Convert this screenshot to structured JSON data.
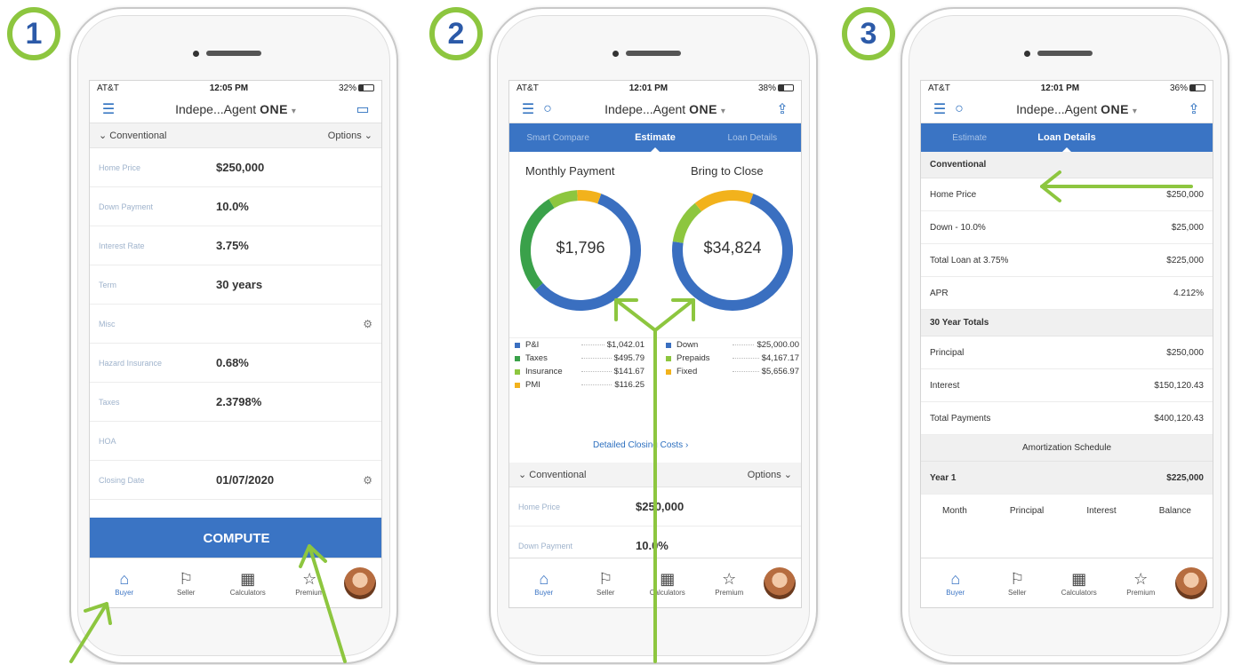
{
  "badges": [
    "1",
    "2",
    "3"
  ],
  "colors": {
    "accent": "#3a74c4",
    "green": "#8dc63f",
    "donut_blue": "#3a6fc0",
    "donut_green_dark": "#3aa14a",
    "donut_green_light": "#8dc63f",
    "donut_yellow": "#f2b21c"
  },
  "status": {
    "p1": {
      "carrier": "AT&T",
      "time": "12:05 PM",
      "battery": "32%"
    },
    "p2": {
      "carrier": "AT&T",
      "time": "12:01 PM",
      "battery": "38%"
    },
    "p3": {
      "carrier": "AT&T",
      "time": "12:01 PM",
      "battery": "36%"
    }
  },
  "nav": {
    "title_prefix": "Indepe...Agent",
    "title_brand": "ONE",
    "chevron": "▾"
  },
  "phone1": {
    "section": "Conventional",
    "options_label": "Options",
    "fields": [
      {
        "label": "Home Price",
        "value": "$250,000"
      },
      {
        "label": "Down Payment",
        "value": "10.0%"
      },
      {
        "label": "Interest Rate",
        "value": "3.75%"
      },
      {
        "label": "Term",
        "value": "30 years"
      },
      {
        "label": "Misc",
        "value": ""
      },
      {
        "label": "Hazard Insurance",
        "value": "0.68%"
      },
      {
        "label": "Taxes",
        "value": "2.3798%"
      },
      {
        "label": "HOA",
        "value": ""
      },
      {
        "label": "Closing Date",
        "value": "01/07/2020"
      }
    ],
    "compute": "COMPUTE"
  },
  "bottom_tabs": [
    "Buyer",
    "Seller",
    "Calculators",
    "Premium"
  ],
  "phone2": {
    "tabs": [
      "Smart Compare",
      "Estimate",
      "Loan Details"
    ],
    "monthly_title": "Monthly Payment",
    "monthly_value": "$1,796",
    "close_title": "Bring to Close",
    "close_value": "$34,824",
    "monthly_legend": [
      {
        "name": "P&I",
        "value": "$1,042.01",
        "color": "#3a6fc0"
      },
      {
        "name": "Taxes",
        "value": "$495.79",
        "color": "#3aa14a"
      },
      {
        "name": "Insurance",
        "value": "$141.67",
        "color": "#8dc63f"
      },
      {
        "name": "PMI",
        "value": "$116.25",
        "color": "#f2b21c"
      }
    ],
    "close_legend": [
      {
        "name": "Down",
        "value": "$25,000.00",
        "color": "#3a6fc0"
      },
      {
        "name": "Prepaids",
        "value": "$4,167.17",
        "color": "#8dc63f"
      },
      {
        "name": "Fixed",
        "value": "$5,656.97",
        "color": "#f2b21c"
      }
    ],
    "monthly_slices": [
      1042.01,
      495.79,
      141.67,
      116.25
    ],
    "close_slices": [
      25000.0,
      4167.17,
      5656.97
    ],
    "detailed_link": "Detailed Closing Costs",
    "section": "Conventional",
    "options_label": "Options",
    "fields": [
      {
        "label": "Home Price",
        "value": "$250,000"
      },
      {
        "label": "Down Payment",
        "value": "10.0%"
      }
    ]
  },
  "phone3": {
    "tabs": [
      "Estimate",
      "Loan Details"
    ],
    "rows": [
      {
        "type": "head",
        "label": "Conventional"
      },
      {
        "type": "row",
        "label": "Home Price",
        "value": "$250,000"
      },
      {
        "type": "row",
        "label": "Down - 10.0%",
        "value": "$25,000"
      },
      {
        "type": "row",
        "label": "Total Loan at 3.75%",
        "value": "$225,000"
      },
      {
        "type": "row",
        "label": "APR",
        "value": "4.212%"
      },
      {
        "type": "head",
        "label": "30 Year Totals"
      },
      {
        "type": "row",
        "label": "Principal",
        "value": "$250,000"
      },
      {
        "type": "row",
        "label": "Interest",
        "value": "$150,120.43"
      },
      {
        "type": "row",
        "label": "Total Payments",
        "value": "$400,120.43"
      }
    ],
    "amort_label": "Amortization Schedule",
    "year_label": "Year 1",
    "year_value": "$225,000",
    "cols": [
      "Month",
      "Principal",
      "Interest",
      "Balance"
    ]
  }
}
